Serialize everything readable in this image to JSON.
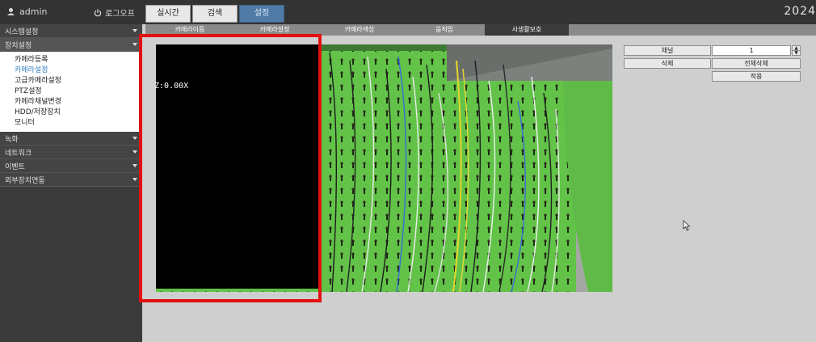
{
  "header": {
    "user": "admin",
    "logout": "로그오프",
    "year": "2024",
    "tabs": [
      {
        "label": "실시간"
      },
      {
        "label": "검색"
      },
      {
        "label": "설정"
      }
    ]
  },
  "sidebar": {
    "sections": [
      {
        "label": "시스템설정"
      },
      {
        "label": "장치설정"
      },
      {
        "label": "녹화"
      },
      {
        "label": "네트워크"
      },
      {
        "label": "이벤트"
      },
      {
        "label": "외부장치연동"
      }
    ],
    "submenu": [
      {
        "label": "카메라등록"
      },
      {
        "label": "카메라설정"
      },
      {
        "label": "고급카메라설정"
      },
      {
        "label": "PTZ설정"
      },
      {
        "label": "카메라채널변경"
      },
      {
        "label": "HDD/저장장치"
      },
      {
        "label": "모니터"
      }
    ]
  },
  "subtabs": [
    {
      "label": "카메라이름"
    },
    {
      "label": "카메라설정"
    },
    {
      "label": "카메라색상"
    },
    {
      "label": "움직임"
    },
    {
      "label": "사생활보호"
    }
  ],
  "video": {
    "zoom_text": "Z:0.00X"
  },
  "panel": {
    "channel_label": "채널",
    "channel_value": "1",
    "delete": "삭제",
    "delete_all": "전체삭제",
    "apply": "적용"
  },
  "colors": {
    "active_tab": "#4f7ba6",
    "privacy_mask": "#000000",
    "highlight": "#e31010",
    "board_green": "#63c24a"
  }
}
